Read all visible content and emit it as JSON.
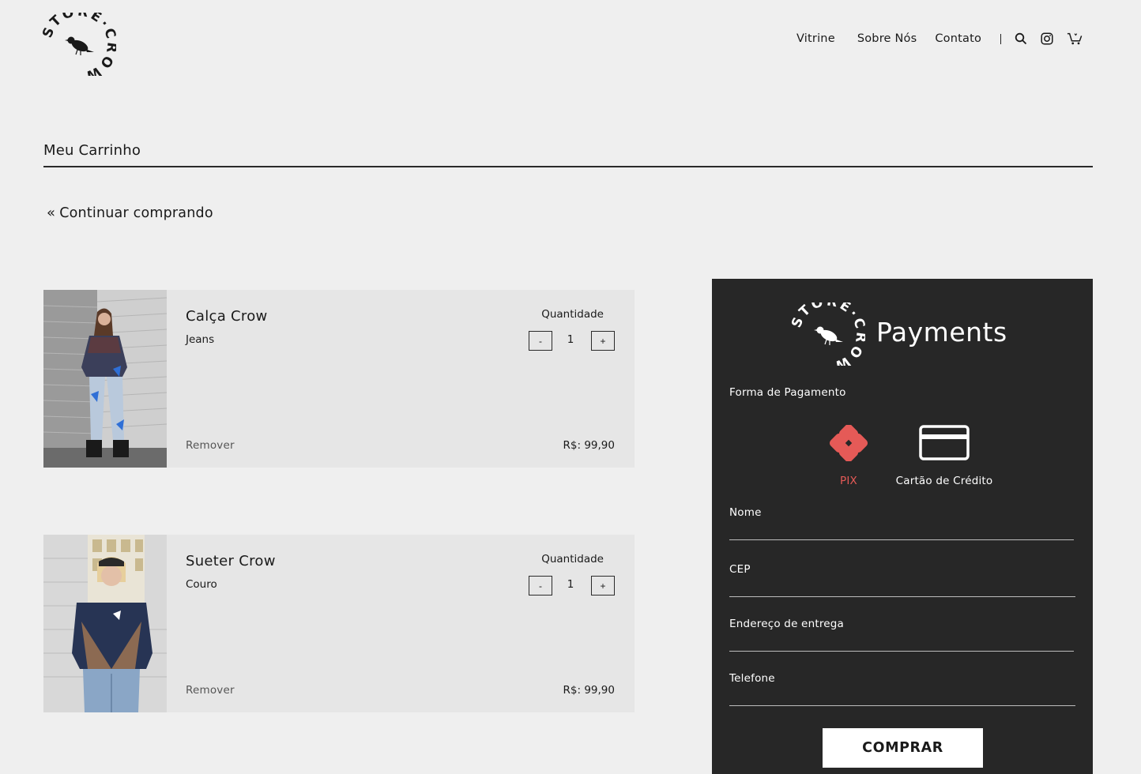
{
  "brand": {
    "logo_text": "STORE·CROW·",
    "logo_icon": "crow-icon"
  },
  "nav": {
    "links": [
      "Vitrine",
      "Sobre Nós",
      "Contato"
    ],
    "icons": [
      "search-icon",
      "instagram-icon",
      "cart-icon"
    ]
  },
  "page": {
    "title": "Meu Carrinho",
    "back_label": "Continuar comprando",
    "back_icon": "double-chevron-left-icon"
  },
  "cart": {
    "items": [
      {
        "name": "Calça Crow",
        "variant": "Jeans",
        "quantity_label": "Quantidade",
        "quantity": "1",
        "minus": "-",
        "plus": "+",
        "remove_label": "Remover",
        "price": "R$: 99,90"
      },
      {
        "name": "Sueter Crow",
        "variant": "Couro",
        "quantity_label": "Quantidade",
        "quantity": "1",
        "minus": "-",
        "plus": "+",
        "remove_label": "Remover",
        "price": "R$: 99,90"
      }
    ]
  },
  "payment": {
    "title": "Payments",
    "method_label": "Forma de Pagamento",
    "methods": [
      {
        "label": "PIX",
        "icon": "pix-icon",
        "color": "#e55a57"
      },
      {
        "label": "Cartão de Crédito",
        "icon": "credit-card-icon",
        "color": "#ffffff"
      }
    ],
    "fields": [
      {
        "label": "Nome",
        "value": ""
      },
      {
        "label": "CEP",
        "value": ""
      },
      {
        "label": "Endereço de entrega",
        "value": ""
      },
      {
        "label": "Telefone",
        "value": ""
      }
    ],
    "submit_label": "COMPRAR"
  },
  "colors": {
    "background": "#efefef",
    "card_background": "#e6e6e6",
    "panel_background": "#272727",
    "pix_accent": "#e55a57"
  }
}
